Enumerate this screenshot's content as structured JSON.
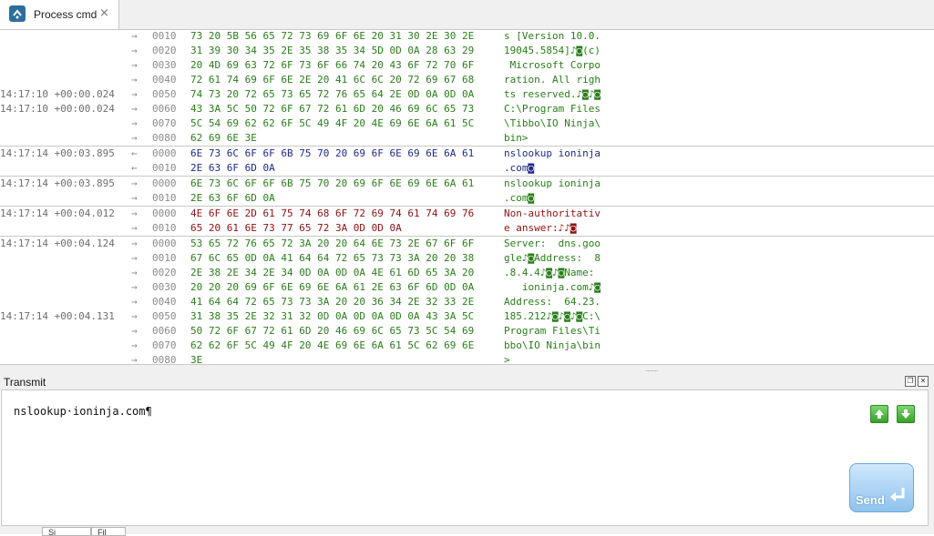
{
  "tab": {
    "title": "Process cmd",
    "close": "×"
  },
  "log": [
    {
      "ts": "",
      "dir": "→",
      "off": "0010",
      "hex": "73 20 5B 56 65 72 73 69 6F 6E 20 31 30 2E 30 2E",
      "ascii": "s [Version 10.0.",
      "color": "green",
      "sep": false
    },
    {
      "ts": "",
      "dir": "→",
      "off": "0020",
      "hex": "31 39 30 34 35 2E 35 38 35 34 5D 0D 0A 28 63 29",
      "ascii": "19045.5854]♪◙(c)",
      "color": "green",
      "sep": false
    },
    {
      "ts": "",
      "dir": "→",
      "off": "0030",
      "hex": "20 4D 69 63 72 6F 73 6F 66 74 20 43 6F 72 70 6F",
      "ascii": " Microsoft Corpo",
      "color": "green",
      "sep": false
    },
    {
      "ts": "",
      "dir": "→",
      "off": "0040",
      "hex": "72 61 74 69 6F 6E 2E 20 41 6C 6C 20 72 69 67 68",
      "ascii": "ration. All righ",
      "color": "green",
      "sep": false
    },
    {
      "ts": "14:17:10 +00:00.024",
      "dir": "→",
      "off": "0050",
      "hex": "74 73 20 72 65 73 65 72 76 65 64 2E 0D 0A 0D 0A",
      "ascii": "ts reserved.♪◙♪◙",
      "color": "green",
      "sep": false
    },
    {
      "ts": "14:17:10 +00:00.024",
      "dir": "→",
      "off": "0060",
      "hex": "43 3A 5C 50 72 6F 67 72 61 6D 20 46 69 6C 65 73",
      "ascii": "C:\\Program Files",
      "color": "green",
      "sep": false
    },
    {
      "ts": "",
      "dir": "→",
      "off": "0070",
      "hex": "5C 54 69 62 62 6F 5C 49 4F 20 4E 69 6E 6A 61 5C",
      "ascii": "\\Tibbo\\IO Ninja\\",
      "color": "green",
      "sep": false
    },
    {
      "ts": "",
      "dir": "→",
      "off": "0080",
      "hex": "62 69 6E 3E",
      "ascii": "bin>",
      "color": "green",
      "sep": false
    },
    {
      "ts": "14:17:14 +00:03.895",
      "dir": "←",
      "off": "0000",
      "hex": "6E 73 6C 6F 6F 6B 75 70 20 69 6F 6E 69 6E 6A 61",
      "ascii": "nslookup ioninja",
      "color": "blue",
      "sep": true
    },
    {
      "ts": "",
      "dir": "←",
      "off": "0010",
      "hex": "2E 63 6F 6D 0A",
      "ascii": ".com◙",
      "color": "blue",
      "sep": false
    },
    {
      "ts": "14:17:14 +00:03.895",
      "dir": "→",
      "off": "0000",
      "hex": "6E 73 6C 6F 6F 6B 75 70 20 69 6F 6E 69 6E 6A 61",
      "ascii": "nslookup ioninja",
      "color": "green",
      "sep": true
    },
    {
      "ts": "",
      "dir": "→",
      "off": "0010",
      "hex": "2E 63 6F 6D 0A",
      "ascii": ".com◙",
      "color": "green",
      "sep": false
    },
    {
      "ts": "14:17:14 +00:04.012",
      "dir": "→",
      "off": "0000",
      "hex": "4E 6F 6E 2D 61 75 74 68 6F 72 69 74 61 74 69 76",
      "ascii": "Non-authoritativ",
      "color": "red",
      "sep": true
    },
    {
      "ts": "",
      "dir": "→",
      "off": "0010",
      "hex": "65 20 61 6E 73 77 65 72 3A 0D 0D 0A",
      "ascii": "e answer:♪♪◙",
      "color": "red",
      "sep": false
    },
    {
      "ts": "14:17:14 +00:04.124",
      "dir": "→",
      "off": "0000",
      "hex": "53 65 72 76 65 72 3A 20 20 64 6E 73 2E 67 6F 6F",
      "ascii": "Server:  dns.goo",
      "color": "green",
      "sep": true
    },
    {
      "ts": "",
      "dir": "→",
      "off": "0010",
      "hex": "67 6C 65 0D 0A 41 64 64 72 65 73 73 3A 20 20 38",
      "ascii": "gle♪◙Address:  8",
      "color": "green",
      "sep": false
    },
    {
      "ts": "",
      "dir": "→",
      "off": "0020",
      "hex": "2E 38 2E 34 2E 34 0D 0A 0D 0A 4E 61 6D 65 3A 20",
      "ascii": ".8.4.4♪◙♪◙Name: ",
      "color": "green",
      "sep": false
    },
    {
      "ts": "",
      "dir": "→",
      "off": "0030",
      "hex": "20 20 20 69 6F 6E 69 6E 6A 61 2E 63 6F 6D 0D 0A",
      "ascii": "   ioninja.com♪◙",
      "color": "green",
      "sep": false
    },
    {
      "ts": "",
      "dir": "→",
      "off": "0040",
      "hex": "41 64 64 72 65 73 73 3A 20 20 36 34 2E 32 33 2E",
      "ascii": "Address:  64.23.",
      "color": "green",
      "sep": false
    },
    {
      "ts": "14:17:14 +00:04.131",
      "dir": "→",
      "off": "0050",
      "hex": "31 38 35 2E 32 31 32 0D 0A 0D 0A 0D 0A 43 3A 5C",
      "ascii": "185.212♪◙♪◙♪◙C:\\",
      "color": "green",
      "sep": false
    },
    {
      "ts": "",
      "dir": "→",
      "off": "0060",
      "hex": "50 72 6F 67 72 61 6D 20 46 69 6C 65 73 5C 54 69",
      "ascii": "Program Files\\Ti",
      "color": "green",
      "sep": false
    },
    {
      "ts": "",
      "dir": "→",
      "off": "0070",
      "hex": "62 62 6F 5C 49 4F 20 4E 69 6E 6A 61 5C 62 69 6E",
      "ascii": "bbo\\IO Ninja\\bin",
      "color": "green",
      "sep": false
    },
    {
      "ts": "",
      "dir": "→",
      "off": "0080",
      "hex": "3E",
      "ascii": ">",
      "color": "green",
      "sep": false
    }
  ],
  "transmit": {
    "title": "Transmit",
    "text": "nslookup·ioninja.com¶",
    "send_label": "Send"
  },
  "bottom_tabs": [
    "Si",
    "Fil"
  ],
  "colors": {
    "rx_green": "#2a7d1a",
    "tx_blue": "#1f2a86",
    "err_red": "#8b1212",
    "accent": "#2b6f9e"
  }
}
